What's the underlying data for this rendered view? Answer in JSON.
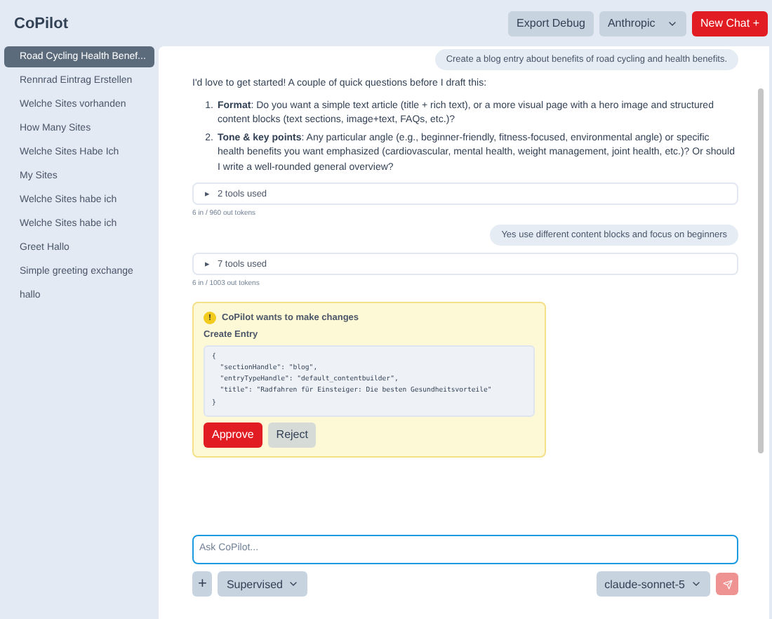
{
  "app": {
    "title": "CoPilot"
  },
  "toolbar": {
    "export_button": "Export Debug",
    "provider": "Anthropic",
    "new_chat_button": "New Chat +"
  },
  "sidebar": {
    "items": [
      {
        "label": "Road Cycling Health Benef...",
        "selected": true
      },
      {
        "label": "Rennrad Eintrag Erstellen",
        "selected": false
      },
      {
        "label": "Welche Sites vorhanden",
        "selected": false
      },
      {
        "label": "How Many Sites",
        "selected": false
      },
      {
        "label": "Welche Sites Habe Ich",
        "selected": false
      },
      {
        "label": "My Sites",
        "selected": false
      },
      {
        "label": "Welche Sites habe ich",
        "selected": false
      },
      {
        "label": "Welche Sites habe ich",
        "selected": false
      },
      {
        "label": "Greet Hallo",
        "selected": false
      },
      {
        "label": "Simple greeting exchange",
        "selected": false
      },
      {
        "label": "hallo",
        "selected": false
      }
    ]
  },
  "messages": [
    {
      "kind": "user",
      "text": "Create a blog entry about benefits of road cycling and health benefits."
    },
    {
      "kind": "assistant",
      "intro": "I'd love to get started! A couple of quick questions before I draft this:",
      "points": [
        {
          "marker": "1.",
          "text": "**Format**: Do you want a simple text article (title + rich text), or a more visual page with a hero image and structured content blocks (text sections, image+text, FAQs, etc.)?"
        },
        {
          "marker": "2.",
          "text": "**Tone & key points**: Any particular angle (e.g., beginner-friendly, fitness-focused, environmental angle) or specific health benefits you want emphasized (cardiovascular, mental health, weight management, joint health, etc.)? Or should I write a well-rounded general overview?"
        }
      ],
      "tools": {
        "marker": "▸",
        "label": "2 tools used",
        "expanded": false
      },
      "tokens": "6 in / 960 out tokens"
    },
    {
      "kind": "user",
      "text": "Yes use different content blocks and focus on beginners"
    },
    {
      "kind": "assistant",
      "tools": {
        "marker": "▸",
        "label": "7 tools used",
        "expanded": false
      },
      "tokens": "6 in / 1003 out tokens"
    }
  ],
  "approval": {
    "icon": "!",
    "title": "CoPilot wants to make changes",
    "action": "Create Entry",
    "code": "{\n  \"sectionHandle\": \"blog\",\n  \"entryTypeHandle\": \"default_contentbuilder\",\n  \"title\": \"Radfahren für Einsteiger: Die besten Gesundheitsvorteile\"\n}",
    "approve_button": "Approve",
    "reject_button": "Reject"
  },
  "composer": {
    "placeholder": "Ask CoPilot...",
    "add_button": "+",
    "mode": "Supervised",
    "model": "claude-sonnet-5",
    "send_disabled": true
  }
}
